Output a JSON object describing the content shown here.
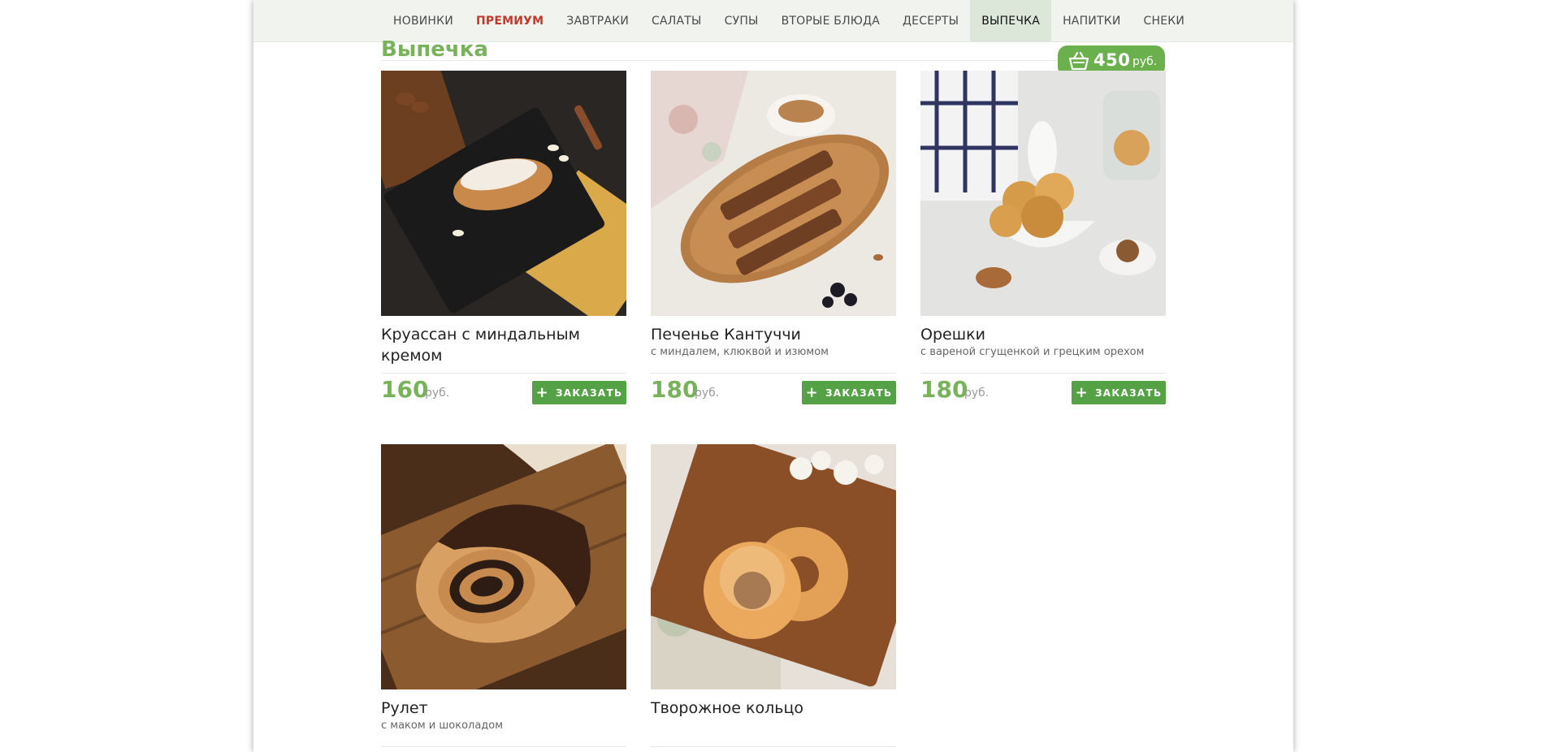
{
  "nav": {
    "items": [
      {
        "label": "НОВИНКИ"
      },
      {
        "label": "ПРЕМИУМ"
      },
      {
        "label": "ЗАВТРАКИ"
      },
      {
        "label": "САЛАТЫ"
      },
      {
        "label": "СУПЫ"
      },
      {
        "label": "ВТОРЫЕ БЛЮДА"
      },
      {
        "label": "ДЕСЕРТЫ"
      },
      {
        "label": "ВЫПЕЧКА"
      },
      {
        "label": "НАПИТКИ"
      },
      {
        "label": "СНЕКИ"
      }
    ],
    "active_label": "ВЫПЕЧКА",
    "premium_color": "#c0392b"
  },
  "section": {
    "title": "Выпечка"
  },
  "cart": {
    "amount": "450",
    "currency": "руб.",
    "icon": "basket-icon"
  },
  "products": [
    {
      "title": "Круассан с миндальным кремом",
      "desc": "",
      "price": "160",
      "currency": "руб.",
      "order_label": "ЗАКАЗАТЬ"
    },
    {
      "title": "Печенье Кантуччи",
      "desc": "с миндалем, клюквой и изюмом",
      "price": "180",
      "currency": "руб.",
      "order_label": "ЗАКАЗАТЬ"
    },
    {
      "title": "Орешки",
      "desc": "с вареной сгущенкой и грецким орехом",
      "price": "180",
      "currency": "руб.",
      "order_label": "ЗАКАЗАТЬ"
    },
    {
      "title": "Рулет",
      "desc": "с маком и шоколадом",
      "price": "",
      "currency": "",
      "order_label": ""
    },
    {
      "title": "Творожное кольцо",
      "desc": "",
      "price": "",
      "currency": "",
      "order_label": ""
    }
  ],
  "colors": {
    "accent": "#78b25a",
    "button": "#55a146",
    "nav_bg": "#f0f3ee"
  }
}
